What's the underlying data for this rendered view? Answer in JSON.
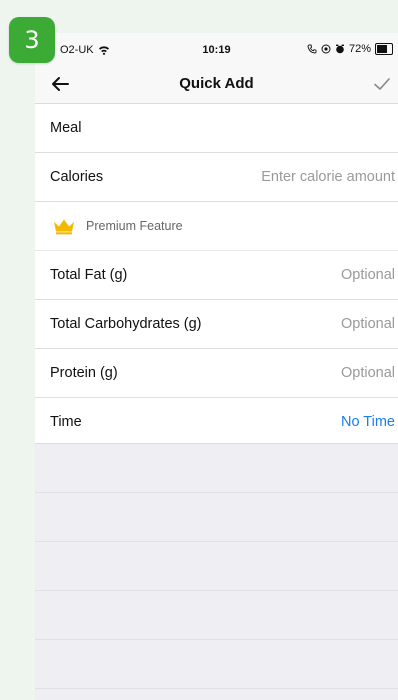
{
  "step": {
    "number": "3",
    "color": "#3cab35"
  },
  "status_bar": {
    "carrier": "O2-UK",
    "time": "10:19",
    "battery": "72%",
    "battery_level": 0.72
  },
  "nav": {
    "title": "Quick Add",
    "back_icon": "arrow-left-icon",
    "done_icon": "checkmark-icon"
  },
  "form": {
    "meal": {
      "label": "Meal",
      "value": ""
    },
    "calories": {
      "label": "Calories",
      "placeholder": "Enter calorie amount"
    },
    "premium": {
      "label": "Premium Feature",
      "icon": "crown-icon",
      "icon_color": "#f5b800"
    },
    "fat": {
      "label": "Total Fat (g)",
      "placeholder": "Optional"
    },
    "carbs": {
      "label": "Total Carbohydrates (g)",
      "placeholder": "Optional"
    },
    "protein": {
      "label": "Protein (g)",
      "placeholder": "Optional"
    },
    "time": {
      "label": "Time",
      "value": "No Time",
      "value_color": "#1b7ee8"
    }
  }
}
